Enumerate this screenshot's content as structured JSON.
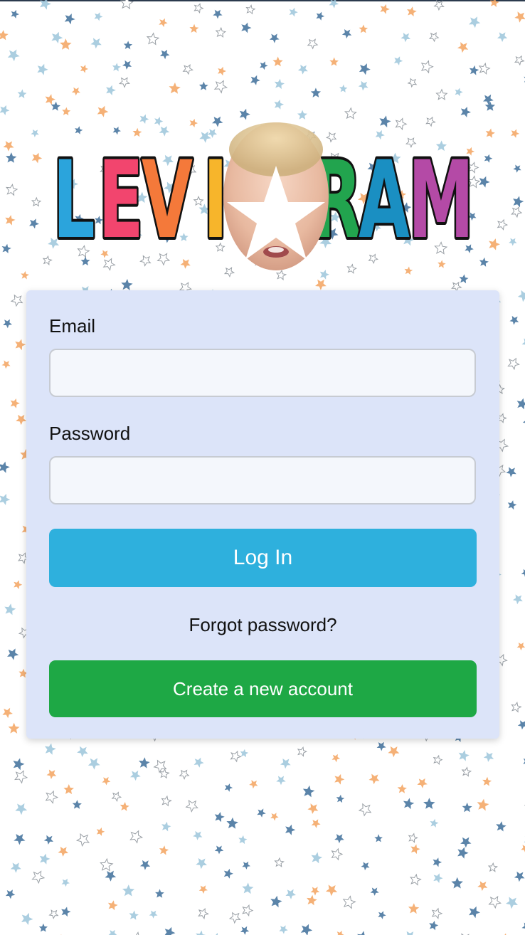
{
  "branding": {
    "logo_text": "LEVIGRAM",
    "logo_letter_colors": [
      "#2ba4dc",
      "#f2456e",
      "#f4793a",
      "#f7b52b",
      "#8ec73f",
      "#22a44e",
      "#1a8fc2",
      "#b44aa6"
    ],
    "logo_outline_color": "#111111"
  },
  "background": {
    "pattern": "star-confetti",
    "star_colors": [
      "#3e6f9a",
      "#f3a35f",
      "#9cc6da",
      "#ffffff"
    ]
  },
  "login_form": {
    "email_label": "Email",
    "email_value": "",
    "email_placeholder": "",
    "password_label": "Password",
    "password_value": "",
    "password_placeholder": "",
    "login_button_label": "Log In",
    "forgot_password_link": "Forgot password?",
    "create_account_button_label": "Create a new account"
  },
  "colors": {
    "card_background": "#dce4f9",
    "login_button": "#2eb0dd",
    "create_account_button": "#1ea845"
  }
}
